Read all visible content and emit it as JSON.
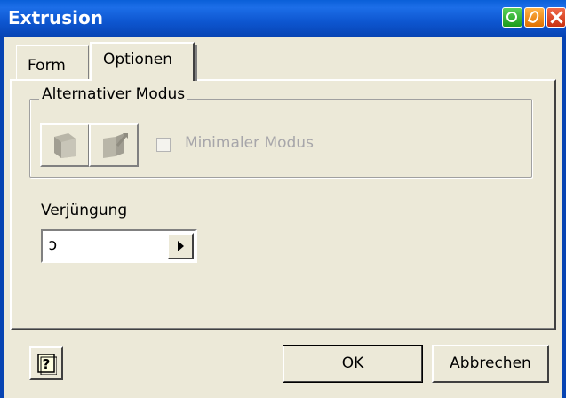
{
  "window": {
    "title": "Extrusion"
  },
  "tabs": [
    {
      "label": "Form"
    },
    {
      "label": "Optionen"
    }
  ],
  "group": {
    "label": "Alternativer Modus",
    "checkbox_label": "Minimaler Modus",
    "checkbox_checked": false
  },
  "taper": {
    "label": "Verjüngung",
    "value": "ɔ"
  },
  "buttons": {
    "ok": "OK",
    "cancel": "Abbrechen"
  }
}
